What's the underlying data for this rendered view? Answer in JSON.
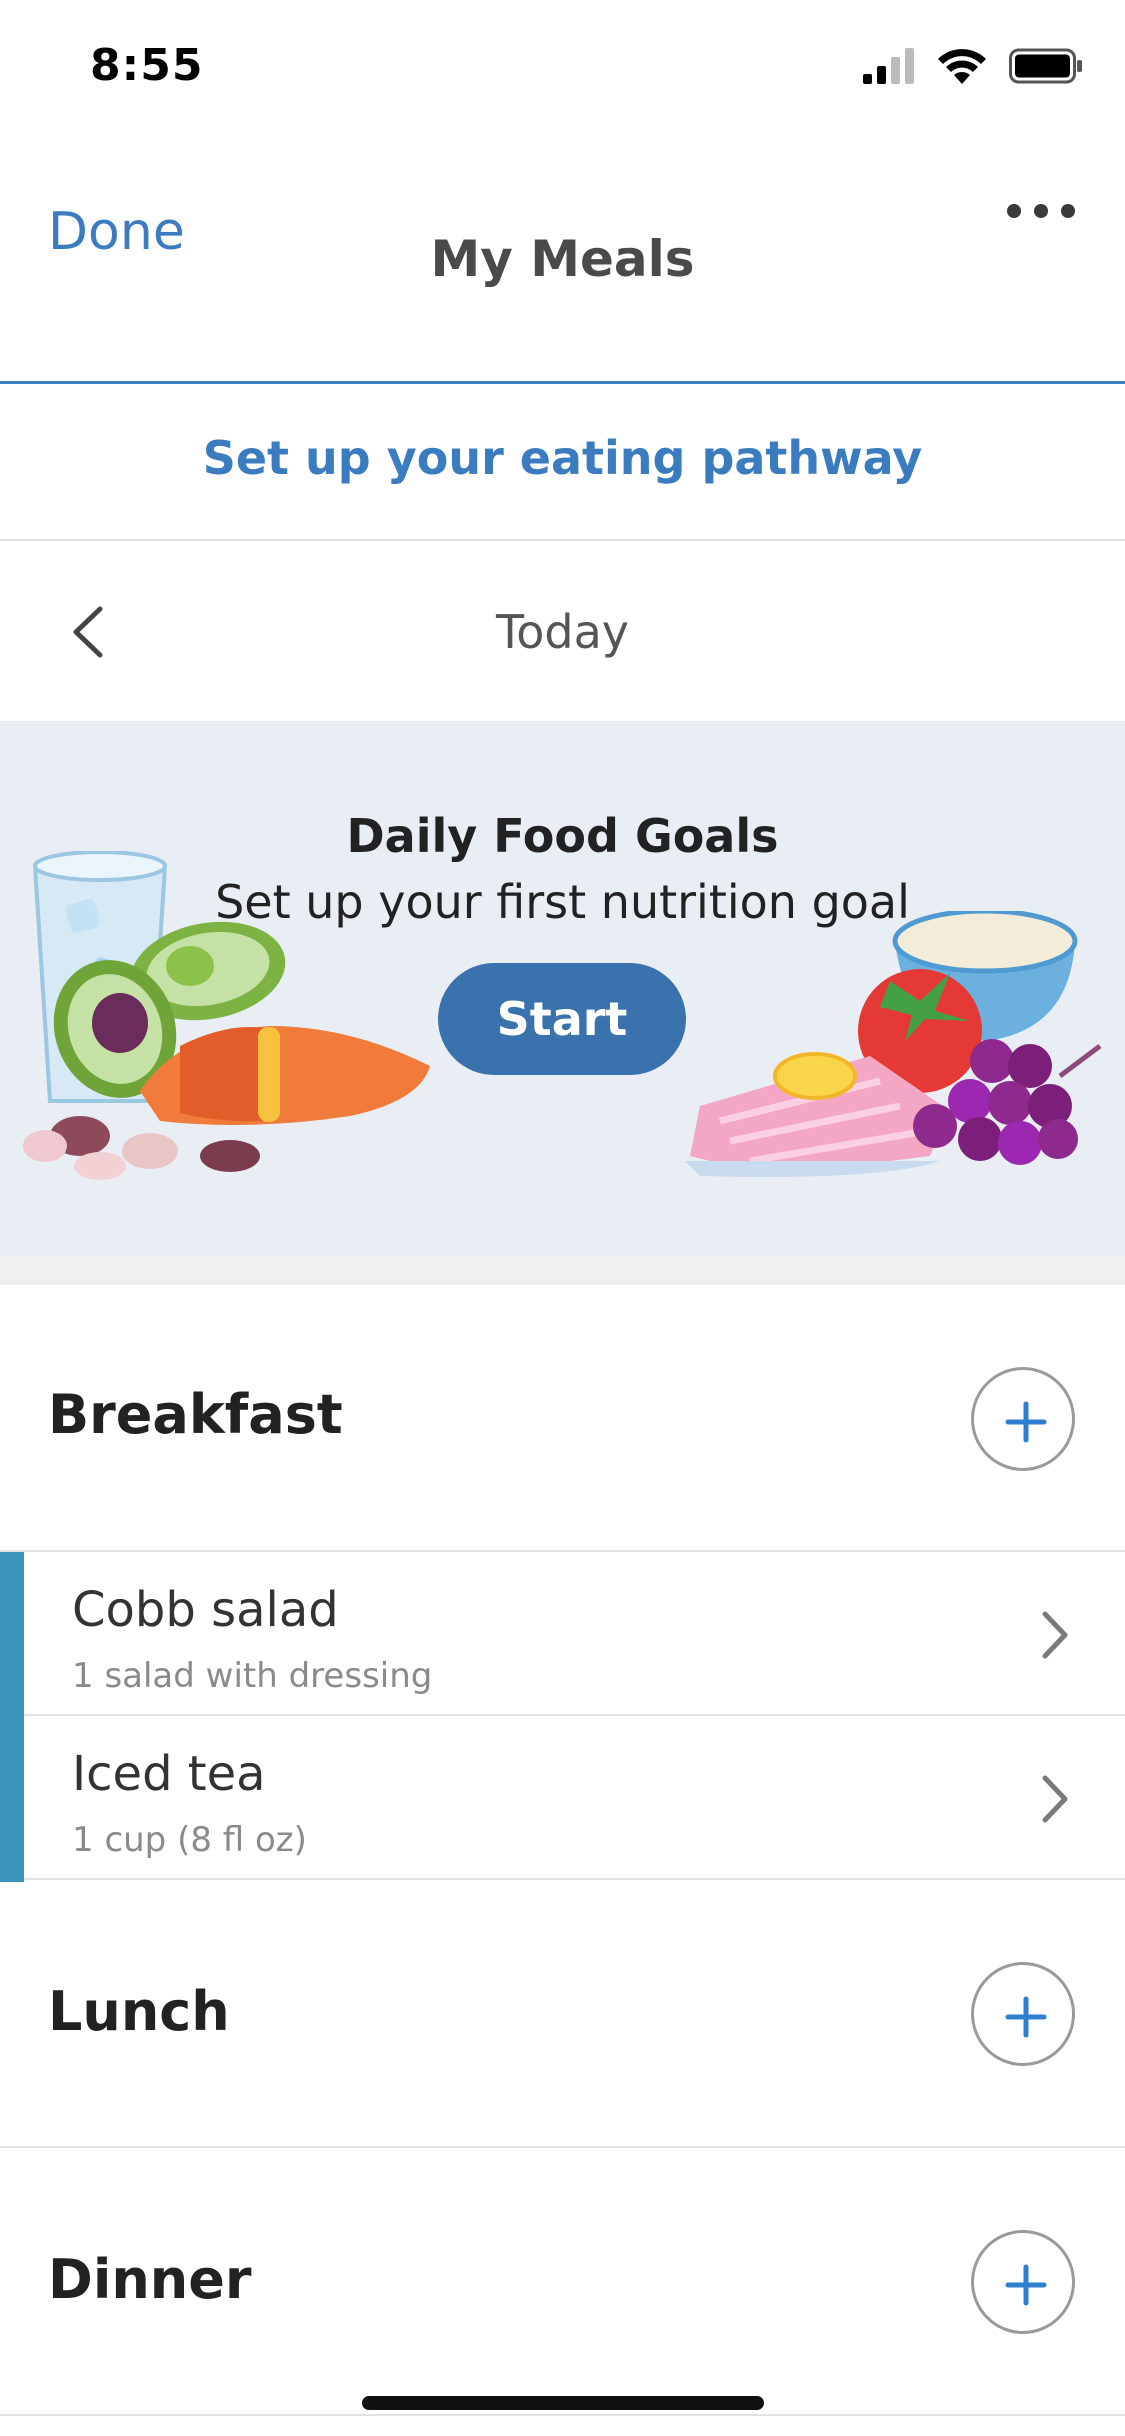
{
  "status_bar": {
    "time": "8:55"
  },
  "nav": {
    "done_label": "Done",
    "title": "My Meals"
  },
  "pathway": {
    "link_label": "Set up your eating pathway"
  },
  "date_nav": {
    "label": "Today"
  },
  "goals_banner": {
    "title": "Daily Food Goals",
    "subtitle": "Set up your first nutrition goal",
    "start_label": "Start"
  },
  "meals": {
    "breakfast": {
      "title": "Breakfast",
      "items": [
        {
          "name": "Cobb salad",
          "detail": "1 salad with dressing"
        },
        {
          "name": "Iced tea",
          "detail": "1 cup (8 fl oz)"
        }
      ]
    },
    "lunch": {
      "title": "Lunch"
    },
    "dinner": {
      "title": "Dinner"
    }
  },
  "colors": {
    "accent_blue": "#3a7cbf",
    "start_button": "#3a72ad",
    "banner_bg": "#e9eef4",
    "item_accent": "#3c94bd"
  },
  "icons": [
    "signal-icon",
    "wifi-icon",
    "battery-icon",
    "more-icon",
    "chevron-left-icon",
    "plus-icon",
    "chevron-right-icon"
  ]
}
